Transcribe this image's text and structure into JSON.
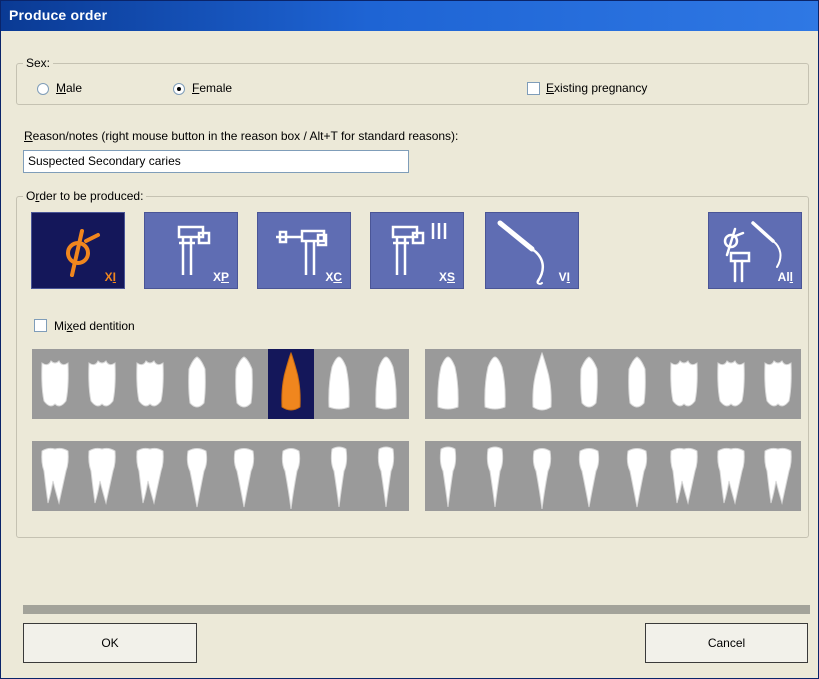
{
  "window": {
    "title": "Produce order"
  },
  "sex": {
    "legend": "Sex:",
    "options": [
      {
        "label": "Male",
        "checked": false
      },
      {
        "label": "Female",
        "checked": true
      }
    ],
    "pregnancy_label": "Existing pregnancy",
    "pregnancy_checked": false
  },
  "reason": {
    "label": "Reason/notes (right mouse button in the reason box / Alt+T for standard reasons):",
    "value": "Suspected Secondary caries"
  },
  "order": {
    "legend": "Order to be produced:",
    "types": [
      {
        "code": "XI",
        "icon": "ballpoint-xray-icon",
        "selected": true
      },
      {
        "code": "XP",
        "icon": "panoramic-xray-icon",
        "selected": false
      },
      {
        "code": "XC",
        "icon": "cephalometric-xray-icon",
        "selected": false
      },
      {
        "code": "XS",
        "icon": "sectional-xray-icon",
        "selected": false
      },
      {
        "code": "VI",
        "icon": "intraoral-camera-icon",
        "selected": false
      },
      {
        "code": "All",
        "icon": "all-orders-icon",
        "selected": false
      }
    ]
  },
  "mixed_dentition": {
    "label": "Mixed dentition",
    "checked": false
  },
  "teeth": {
    "selected_upper_index": 5
  },
  "buttons": {
    "ok": "OK",
    "cancel": "Cancel"
  },
  "colors": {
    "title_bar": "#1e64d4",
    "order_button": "#5f6db3",
    "order_selected": "#14175a",
    "accent": "#f0861e",
    "tooth_row": "#9a9a9a"
  }
}
